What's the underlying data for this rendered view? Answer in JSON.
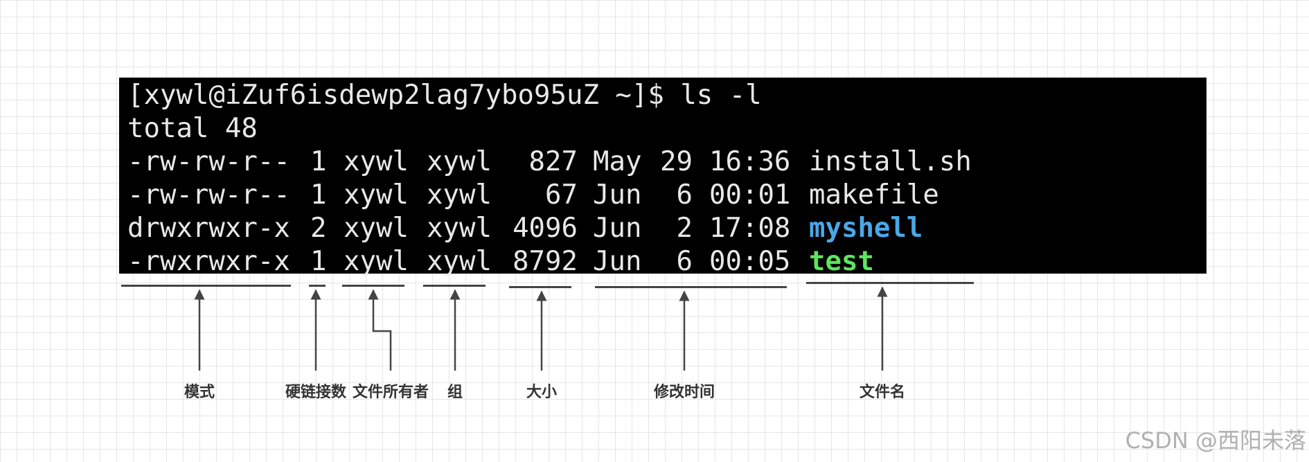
{
  "terminal": {
    "prompt": "[xywl@iZuf6isdewp2lag7ybo95uZ ~]$ ls -l",
    "total": "total 48",
    "rows": [
      {
        "perm": "-rw-rw-r--",
        "links": "1",
        "owner": "xywl",
        "group": "xywl",
        "size": "827",
        "month": "May",
        "day": "29",
        "time": "16:36",
        "name": "install.sh",
        "type": "file"
      },
      {
        "perm": "-rw-rw-r--",
        "links": "1",
        "owner": "xywl",
        "group": "xywl",
        "size": "67",
        "month": "Jun",
        "day": "6",
        "time": "00:01",
        "name": "makefile",
        "type": "file"
      },
      {
        "perm": "drwxrwxr-x",
        "links": "2",
        "owner": "xywl",
        "group": "xywl",
        "size": "4096",
        "month": "Jun",
        "day": "2",
        "time": "17:08",
        "name": "myshell",
        "type": "dir"
      },
      {
        "perm": "-rwxrwxr-x",
        "links": "1",
        "owner": "xywl",
        "group": "xywl",
        "size": "8792",
        "month": "Jun",
        "day": "6",
        "time": "00:05",
        "name": "test",
        "type": "exec"
      }
    ]
  },
  "labels": {
    "mode": "模式",
    "hard_links": "硬链接数",
    "owner": "文件所有者",
    "group": "组",
    "size": "大小",
    "mtime": "修改时间",
    "filename": "文件名"
  },
  "watermark": "CSDN @西阳未落",
  "colors": {
    "terminal_bg": "#000000",
    "terminal_text": "#e8e8e8",
    "directory": "#4aa8e8",
    "executable": "#5ce65c",
    "annotation": "#444444"
  }
}
